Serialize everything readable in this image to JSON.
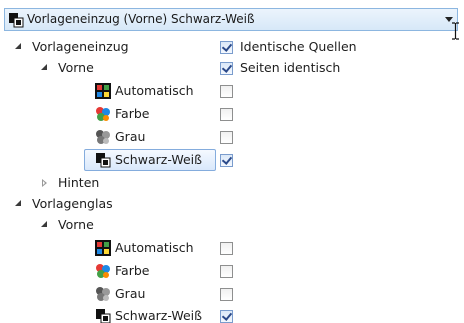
{
  "dropdown": {
    "value": "Vorlageneinzug (Vorne) Schwarz-Weiß"
  },
  "tree": {
    "vorlageneinzug": {
      "label": "Vorlageneinzug",
      "option_label": "Identische Quellen",
      "option_checked": true,
      "vorne": {
        "label": "Vorne",
        "option_label": "Seiten identisch",
        "option_checked": true,
        "items": [
          {
            "label": "Automatisch",
            "icon": "color-grid-icon",
            "checked": false
          },
          {
            "label": "Farbe",
            "icon": "color-palette-icon",
            "checked": false
          },
          {
            "label": "Grau",
            "icon": "gray-palette-icon",
            "checked": false
          },
          {
            "label": "Schwarz-Weiß",
            "icon": "black-white-icon",
            "checked": true,
            "selected": true
          }
        ]
      },
      "hinten": {
        "label": "Hinten"
      }
    },
    "vorlagenglas": {
      "label": "Vorlagenglas",
      "vorne": {
        "label": "Vorne",
        "items": [
          {
            "label": "Automatisch",
            "icon": "color-grid-icon",
            "checked": false
          },
          {
            "label": "Farbe",
            "icon": "color-palette-icon",
            "checked": false
          },
          {
            "label": "Grau",
            "icon": "gray-palette-icon",
            "checked": false
          },
          {
            "label": "Schwarz-Weiß",
            "icon": "black-white-icon",
            "checked": true
          }
        ]
      }
    }
  },
  "colors": {
    "selection_border": "#84acdd",
    "combo_border": "#8cb6e0",
    "check_mark": "#2b4a8a"
  }
}
